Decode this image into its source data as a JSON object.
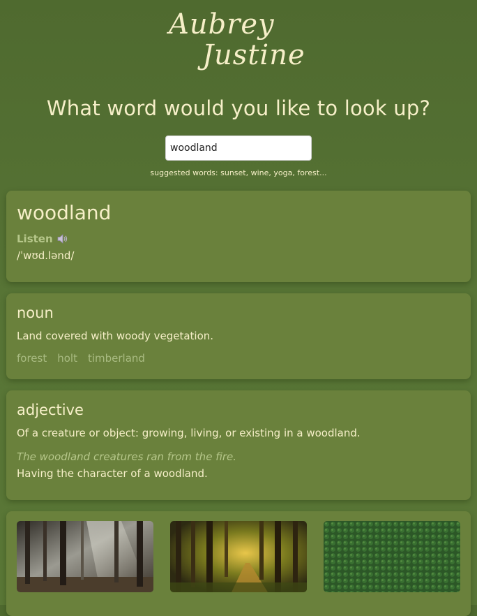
{
  "logo": {
    "line1": "Aubrey",
    "line2": "Justine"
  },
  "headline": "What word would you like to look up?",
  "search": {
    "value": "woodland",
    "placeholder": ""
  },
  "suggested": {
    "prefix": "suggested words:",
    "words": [
      "sunset",
      "wine",
      "yoga",
      "forest..."
    ]
  },
  "word": {
    "title": "woodland",
    "listen_label": "Listen",
    "phonetic": "/ˈwʊd.lənd/"
  },
  "meanings": [
    {
      "part_of_speech": "noun",
      "definitions": [
        "Land covered with woody vegetation."
      ],
      "synonyms": [
        "forest",
        "holt",
        "timberland"
      ]
    },
    {
      "part_of_speech": "adjective",
      "definition_1": "Of a creature or object: growing, living, or existing in a woodland.",
      "example": "The woodland creatures ran from the fire.",
      "definition_2": "Having the character of a woodland."
    }
  ],
  "images": [
    {
      "icon": "misty-forest-photo"
    },
    {
      "icon": "sunlit-forest-path-photo"
    },
    {
      "icon": "aerial-conifer-forest-photo"
    }
  ],
  "colors": {
    "background": "#587536",
    "card": "#6a813c",
    "text": "#f6efc8",
    "muted": "#a9bb82"
  }
}
